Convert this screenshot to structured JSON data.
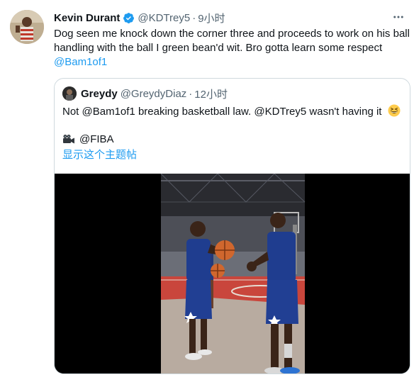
{
  "tweet": {
    "author_name": "Kevin Durant",
    "handle": "@KDTrey5",
    "separator": "·",
    "time": "9小时",
    "text_line1": "Dog seen me knock down the corner three and proceeds to work on his ball",
    "text_line2": "handling with the ball I green bean'd wit. Bro gotta learn some respect",
    "mention": "@Bam1of1",
    "more_icon": "more-horizontal-icon",
    "verified_icon": "verified-badge-icon"
  },
  "quoted": {
    "author_name": "Greydy",
    "handle": "@GreydyDiaz",
    "separator": "·",
    "time": "12小时",
    "text": "Not @Bam1of1 breaking basketball law. @KDTrey5 wasn't having it",
    "emoji": "grinning-squinting-face-icon",
    "credit_icon": "video-camera-icon",
    "credit": "@FIBA",
    "show_thread": "显示这个主题帖"
  },
  "colors": {
    "link": "#1d9bf0",
    "muted": "#536471",
    "border": "#cfd9de",
    "court": "#c9463c"
  }
}
